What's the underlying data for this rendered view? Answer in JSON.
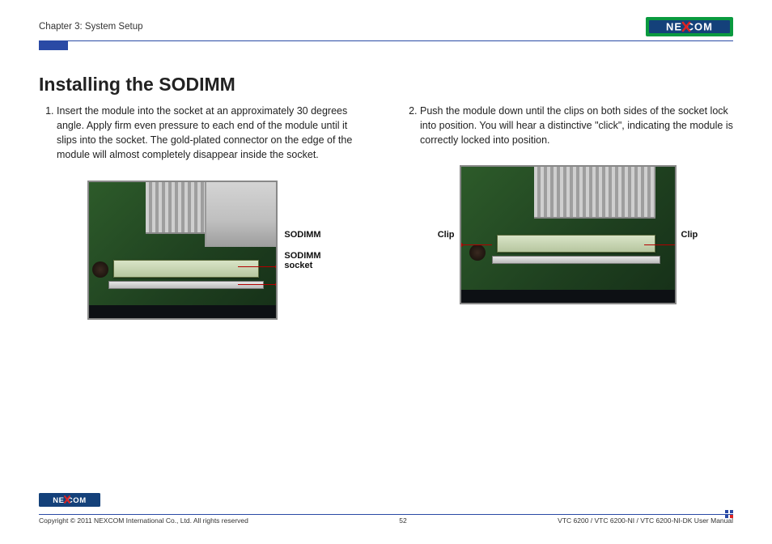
{
  "header": {
    "chapter": "Chapter 3: System Setup",
    "brand": "NEXCOM"
  },
  "title": "Installing the SODIMM",
  "steps": {
    "one": "Insert the module into the socket at an approximately 30 degrees angle. Apply firm even pressure to each end of the module until it slips into the socket. The gold-plated connector on the edge of the module will almost completely disappear inside the socket.",
    "two": "Push the module down until the clips on both sides of the socket lock into position. You will hear a distinctive \"click\", indicating the module is correctly locked into position."
  },
  "callouts": {
    "sodimm": "SODIMM",
    "socket_line1": "SODIMM",
    "socket_line2": "socket",
    "clip_left": "Clip",
    "clip_right": "Clip"
  },
  "footer": {
    "copyright": "Copyright © 2011 NEXCOM International Co., Ltd. All rights reserved",
    "page": "52",
    "doc": "VTC 6200 / VTC 6200-NI / VTC 6200-NI-DK User Manual",
    "brand": "NEXCOM"
  }
}
